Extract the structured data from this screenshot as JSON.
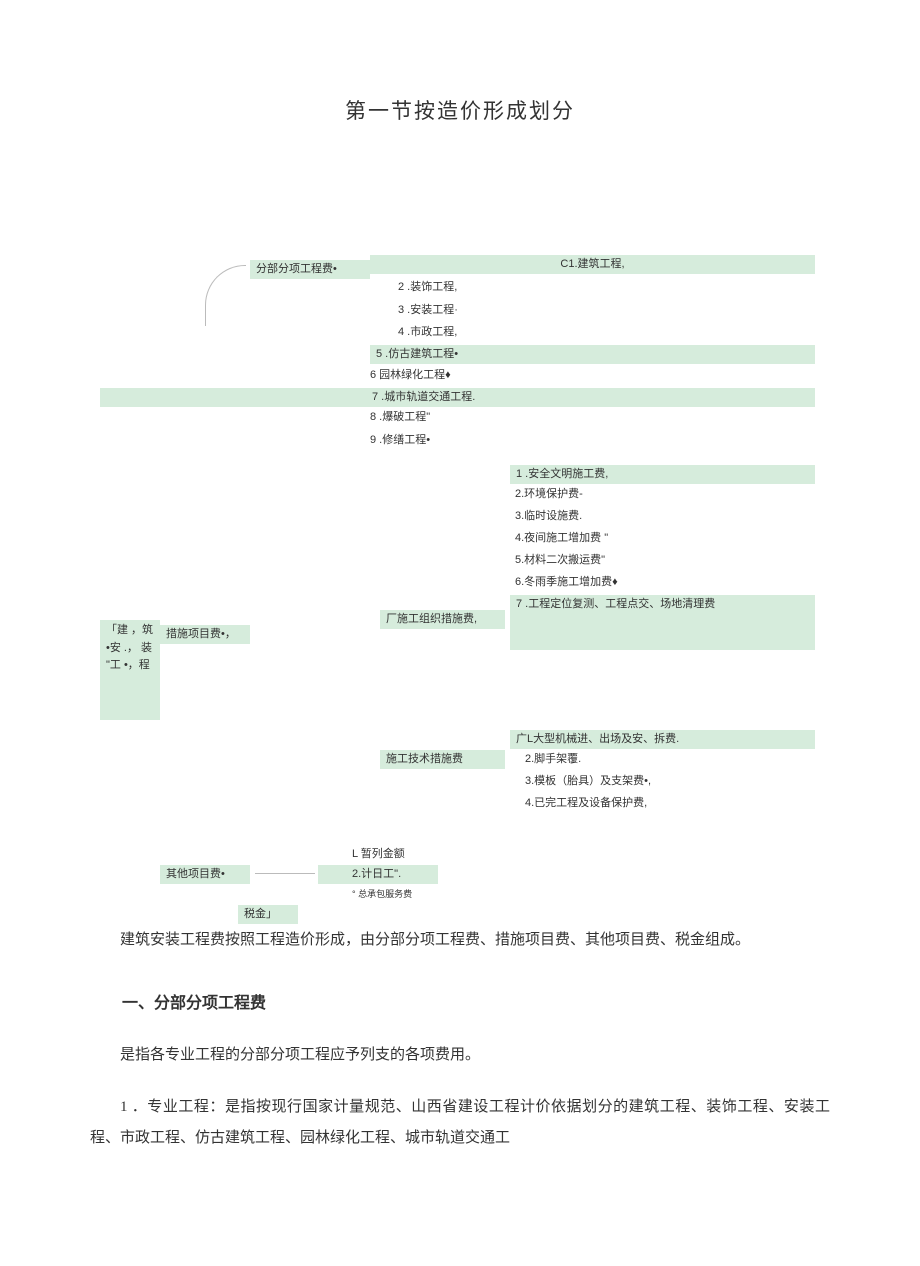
{
  "title": "第一节按造价形成划分",
  "diagram": {
    "root": "「建  ，筑  •安 .，  装    \"工  •，程",
    "level1": {
      "a": "分部分项工程费•",
      "b": "措施项目费•，",
      "c": "其他项目费•",
      "d": "税金」"
    },
    "fbfx": {
      "x1": "C1.建筑工程,",
      "x2": "2 .装饰工程,",
      "x3": "3 .安装工程·",
      "x4": "4 .市政工程,",
      "x5": "5   .仿古建筑工程•",
      "x6": "6    园林绿化工程♦",
      "x7": "7   .城市轨道交通工程.",
      "x8": "8   .爆破工程\"",
      "x9": "9   .修缮工程•"
    },
    "csxm": {
      "org_label": "厂施工组织措施费,",
      "tech_label": "施工技术措施费",
      "org": {
        "o1": "1          .安全文明施工费,",
        "o2": "2.环境保护费-",
        "o3": "3.临时设施费.",
        "o4": "4.夜间施工增加费 \"",
        "o5": "5.材料二次搬运费\"",
        "o6": "6.冬雨季施工增加费♦",
        "o7": "7          .工程定位复测、工程点交、场地清理费",
        "o8": ""
      },
      "tech": {
        "t1": "广L大型机械进、出场及安、拆费.",
        "t2": "2.脚手架覆.",
        "t3": "3.模板（胎具）及支架费•,",
        "t4": "4.已完工程及设备保护费,"
      }
    },
    "other": {
      "p1": "L 暂列金额",
      "p2": "2.计日工\".",
      "p3": "° 总承包服务费"
    }
  },
  "paragraphs": {
    "p1": "建筑安装工程费按照工程造价形成，由分部分项工程费、措施项目费、其他项目费、税金组成。",
    "h1": "一、分部分项工程费",
    "p2": "是指各专业工程的分部分项工程应予列支的各项费用。",
    "p3": "1 ．专业工程：是指按现行国家计量规范、山西省建设工程计价依据划分的建筑工程、装饰工程、安装工程、市政工程、仿古建筑工程、园林绿化工程、城市轨道交通工"
  }
}
